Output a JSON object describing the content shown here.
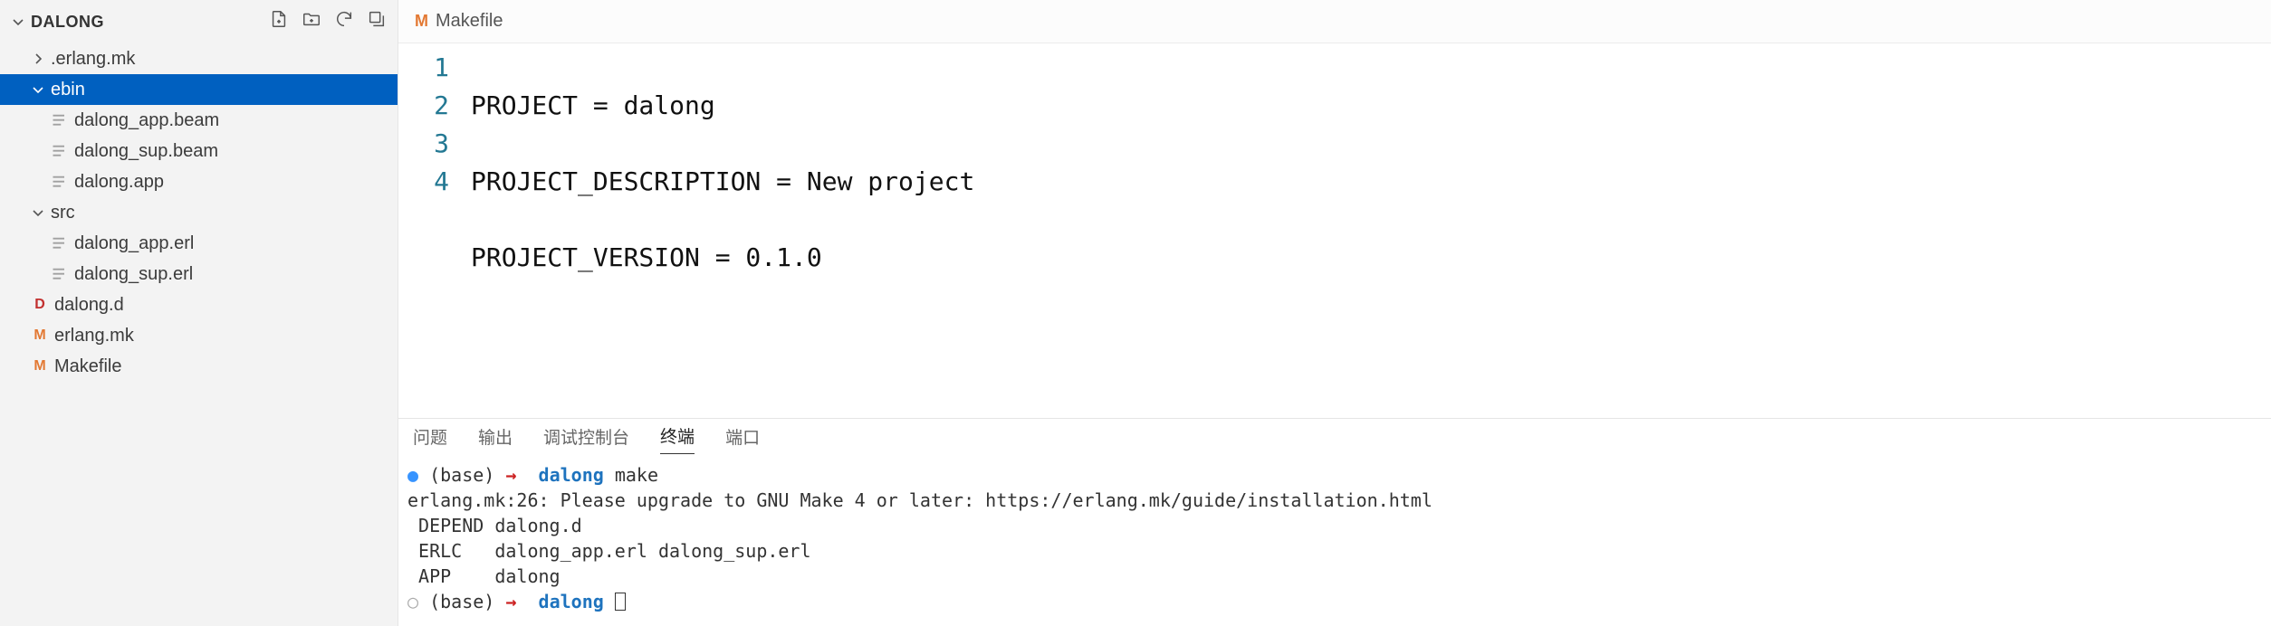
{
  "sidebar": {
    "title": "DALONG",
    "tree": {
      "folder_erlangmk": ".erlang.mk",
      "folder_ebin": "ebin",
      "ebin_files": {
        "dalong_app_beam": "dalong_app.beam",
        "dalong_sup_beam": "dalong_sup.beam",
        "dalong_app": "dalong.app"
      },
      "folder_src": "src",
      "src_files": {
        "dalong_app_erl": "dalong_app.erl",
        "dalong_sup_erl": "dalong_sup.erl"
      },
      "file_dalong_d": "dalong.d",
      "file_erlang_mk": "erlang.mk",
      "file_makefile": "Makefile"
    }
  },
  "editor": {
    "tab_icon": "M",
    "tab_name": "Makefile",
    "lines": {
      "n1": "1",
      "c1": "PROJECT = dalong",
      "n2": "2",
      "c2": "PROJECT_DESCRIPTION = New project",
      "n3": "3",
      "c3": "PROJECT_VERSION = 0.1.0",
      "n4": "4",
      "c4": ""
    }
  },
  "panel": {
    "tabs": {
      "problems": "问题",
      "output": "输出",
      "debug": "调试控制台",
      "terminal": "终端",
      "ports": "端口"
    },
    "terminal": {
      "prompt1_env": "(base)",
      "prompt1_arrow": "→",
      "prompt1_cwd": "dalong",
      "prompt1_cmd": "make",
      "out1": "erlang.mk:26: Please upgrade to GNU Make 4 or later: https://erlang.mk/guide/installation.html",
      "out2": " DEPEND dalong.d",
      "out3": " ERLC   dalong_app.erl dalong_sup.erl",
      "out4": " APP    dalong",
      "prompt2_env": "(base)",
      "prompt2_arrow": "→",
      "prompt2_cwd": "dalong"
    }
  }
}
